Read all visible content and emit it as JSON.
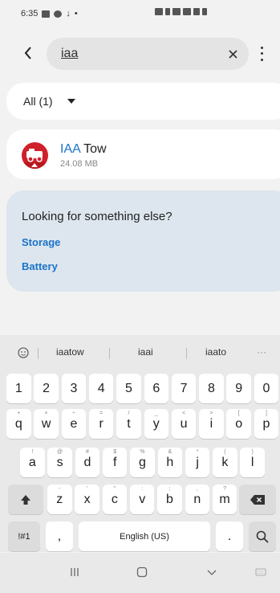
{
  "status_bar": {
    "time": "6:35"
  },
  "search": {
    "query": "iaa"
  },
  "filter": {
    "label": "All (1)"
  },
  "result": {
    "title_highlight": "IAA",
    "title_rest": " Tow",
    "size": "24.08 MB"
  },
  "looking": {
    "title": "Looking for something else?",
    "links": [
      "Storage",
      "Battery"
    ]
  },
  "keyboard": {
    "suggestions": [
      "iaatow",
      "iaai",
      "iaato"
    ],
    "more": "···",
    "row_numbers": [
      "1",
      "2",
      "3",
      "4",
      "5",
      "6",
      "7",
      "8",
      "9",
      "0"
    ],
    "row1": [
      "q",
      "w",
      "e",
      "r",
      "t",
      "y",
      "u",
      "i",
      "o",
      "p"
    ],
    "row1_sub": [
      "+",
      "×",
      "÷",
      "=",
      "/",
      "_",
      "<",
      ">",
      "[",
      "]"
    ],
    "row2": [
      "a",
      "s",
      "d",
      "f",
      "g",
      "h",
      "j",
      "k",
      "l"
    ],
    "row2_sub": [
      "!",
      "@",
      "#",
      "$",
      "%",
      "&",
      "*",
      "(",
      ")"
    ],
    "row3": [
      "z",
      "x",
      "c",
      "v",
      "b",
      "n",
      "m"
    ],
    "row3_sub": [
      "-",
      "'",
      "\"",
      ":",
      ";",
      ",",
      "?"
    ],
    "symbols_label": "!#1",
    "comma": ",",
    "space_label": "English (US)",
    "period": "."
  }
}
